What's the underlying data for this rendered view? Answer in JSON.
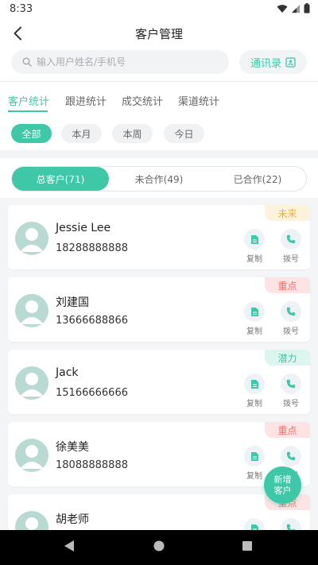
{
  "status_bar": {
    "time": "8:33"
  },
  "header": {
    "title": "客户管理"
  },
  "search": {
    "placeholder": "输入用户姓名/手机号",
    "contacts_label": "通讯录"
  },
  "tabs": [
    {
      "label": "客户统计",
      "active": true
    },
    {
      "label": "跟进统计",
      "active": false
    },
    {
      "label": "成交统计",
      "active": false
    },
    {
      "label": "渠道统计",
      "active": false
    }
  ],
  "filters": [
    {
      "label": "全部",
      "active": true
    },
    {
      "label": "本月",
      "active": false
    },
    {
      "label": "本周",
      "active": false
    },
    {
      "label": "今日",
      "active": false
    }
  ],
  "segments": [
    {
      "label": "总客户(71)",
      "active": true
    },
    {
      "label": "未合作(49)",
      "active": false
    },
    {
      "label": "已合作(22)",
      "active": false
    }
  ],
  "actions": {
    "copy_label": "复制",
    "call_label": "拨号"
  },
  "customers": [
    {
      "name": "Jessie Lee",
      "phone": "18288888888",
      "tag": "未来",
      "tag_color": "#e9b23a",
      "tag_bg": "#fdf3dd"
    },
    {
      "name": "刘建国",
      "phone": "13666688866",
      "tag": "重点",
      "tag_color": "#ee6b6b",
      "tag_bg": "#fde3e3"
    },
    {
      "name": "Jack",
      "phone": "15166666666",
      "tag": "潜力",
      "tag_color": "#3fc8a7",
      "tag_bg": "#dcf5ee"
    },
    {
      "name": "徐美美",
      "phone": "18088888888",
      "tag": "重点",
      "tag_color": "#ee6b6b",
      "tag_bg": "#fde3e3"
    },
    {
      "name": "胡老师",
      "phone": "",
      "tag": "重点",
      "tag_color": "#ee6b6b",
      "tag_bg": "#fde3e3"
    }
  ],
  "fab": {
    "label": "新增客户"
  },
  "colors": {
    "accent": "#3fc8a7"
  }
}
